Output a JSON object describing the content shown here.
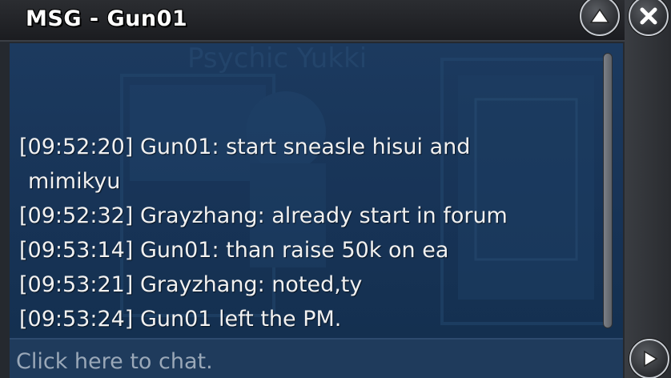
{
  "window": {
    "title": "MSG - Gun01"
  },
  "background_art": {
    "faint_text": "Psychic Yukki"
  },
  "chat": {
    "messages": [
      {
        "timestamp": "[09:52:20]",
        "text": "Gun01: start sneasle hisui and",
        "continuation": "mimikyu"
      },
      {
        "timestamp": "[09:52:32]",
        "text": "Grayzhang: already start in forum"
      },
      {
        "timestamp": "[09:53:14]",
        "text": "Gun01: than raise 50k on ea"
      },
      {
        "timestamp": "[09:53:21]",
        "text": "Grayzhang: noted,ty"
      },
      {
        "timestamp": "[09:53:24]",
        "text": "Gun01 left the PM."
      }
    ]
  },
  "input": {
    "placeholder": "Click here to chat."
  },
  "icons": {
    "up": "chevron-up-icon",
    "close": "close-icon",
    "send": "play-arrow-icon"
  },
  "colors": {
    "chat_bg": "#1c3a5f",
    "text": "#f1f1f1",
    "titlebar": "#1b1c20"
  }
}
